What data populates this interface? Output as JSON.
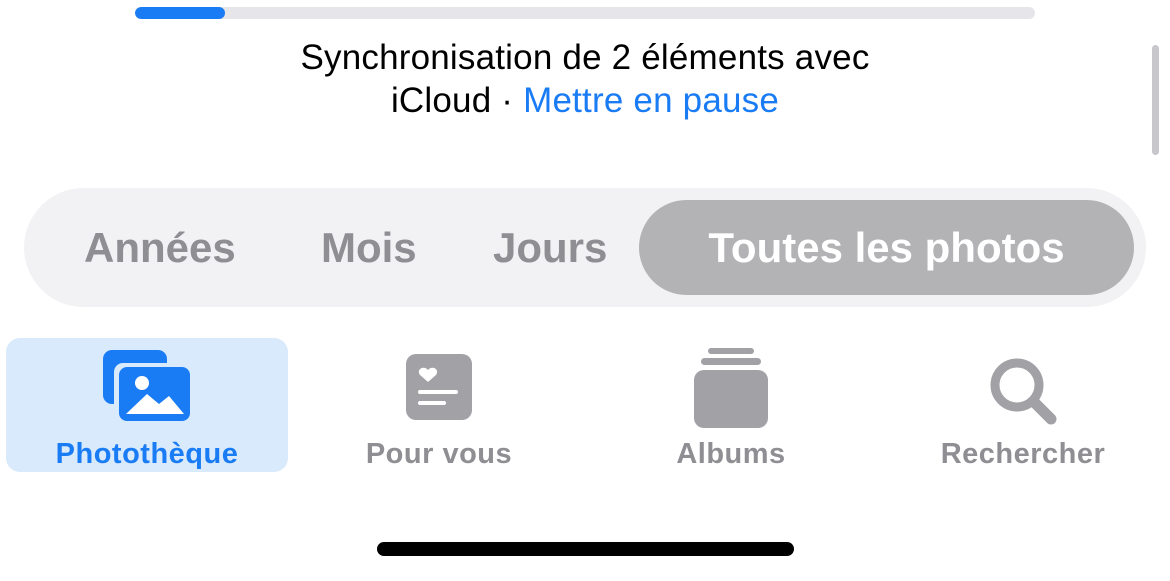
{
  "sync": {
    "progress": 0.1,
    "line1": "Synchronisation de 2 éléments avec",
    "line2_prefix": "iCloud · ",
    "pause_label": "Mettre en pause"
  },
  "view_selector": {
    "options": [
      "Années",
      "Mois",
      "Jours",
      "Toutes les photos"
    ],
    "selected": "Toutes les photos"
  },
  "tab_bar": {
    "tabs": [
      {
        "label": "Photothèque",
        "icon": "photo-library-icon",
        "active": true
      },
      {
        "label": "Pour vous",
        "icon": "for-you-icon",
        "active": false
      },
      {
        "label": "Albums",
        "icon": "albums-icon",
        "active": false
      },
      {
        "label": "Rechercher",
        "icon": "search-icon",
        "active": false
      }
    ]
  },
  "colors": {
    "accent": "#1a7cf5",
    "inactive": "#8e8e93",
    "segment_bg": "#f2f2f4",
    "segment_selected": "#b3b3b6",
    "active_tab_bg": "#d8eafb"
  }
}
